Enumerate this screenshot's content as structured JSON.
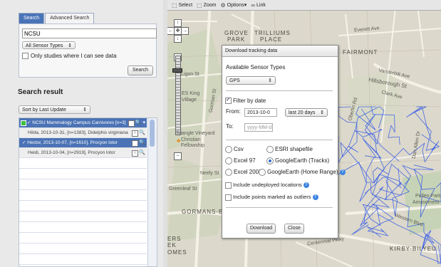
{
  "search_panel": {
    "tabs": [
      {
        "label": "Search"
      },
      {
        "label": "Advanced Search"
      }
    ],
    "query": "NCSU",
    "sensor_select": "All Sensor Types",
    "only_label": "Only studies where I can see data",
    "search_button": "Search"
  },
  "results": {
    "title": "Search result",
    "sort_select": "Sort by Last Update",
    "rows": [
      {
        "label": "NCSU Mammalogy Campus Carnivores [n=3]"
      },
      {
        "label": "Hilda, 2013-10-31, [n=1383], Didelphis virginiana"
      },
      {
        "label": "Hector, 2013-10-07, [n=1610], Procyon lotor"
      },
      {
        "label": "Heidi, 2013-10-04, [n=2919], Procyon lotor"
      }
    ]
  },
  "toolbar": {
    "select": "Select",
    "zoom": "Zoom",
    "options": "Options",
    "link": "Link"
  },
  "map_labels": [
    {
      "text": "GROVE"
    },
    {
      "text": "PARK"
    },
    {
      "text": "TRILLIUMS"
    },
    {
      "text": "PLACE"
    },
    {
      "text": "FAIRMONT"
    },
    {
      "text": "Everett Ave"
    },
    {
      "text": "ES King"
    },
    {
      "text": "Village"
    },
    {
      "text": "Ligon St"
    },
    {
      "text": "Gorman St"
    },
    {
      "text": "Triangle Vineyard"
    },
    {
      "text": "Christian"
    },
    {
      "text": "Fellowship"
    },
    {
      "text": "Greenleaf St"
    },
    {
      "text": "GORMANS-BURT"
    },
    {
      "text": "Hillsborough St"
    },
    {
      "text": "Neely St"
    },
    {
      "text": "Western Blvd"
    },
    {
      "text": "Centennial Pkwy"
    },
    {
      "text": "KIRBY-BILYEU"
    },
    {
      "text": "ERS"
    },
    {
      "text": "EK"
    },
    {
      "text": "OMES"
    },
    {
      "text": "Pullen Park"
    },
    {
      "text": "Amusement"
    },
    {
      "text": "Dan Allen Dr"
    },
    {
      "text": "Vanderbilt Ave"
    },
    {
      "text": "Clark Ave"
    },
    {
      "text": "Oberlin Rd"
    }
  ],
  "dialog": {
    "title": "Download tracking data",
    "sensor_label": "Available Sensor Types",
    "sensor_value": "GPS",
    "filter_label": "Filter by date",
    "from_label": "From:",
    "from_value": "2013-10-0",
    "range_value": "last 20 days",
    "to_label": "To:",
    "to_placeholder": "yyyy-MM-d",
    "formats": {
      "csv": "Csv",
      "esri": "ESRI shapefile",
      "excel97": "Excel 97",
      "ge_tracks": "GoogleEarth (Tracks)",
      "excel2007": "Excel 2007",
      "ge_home": "GoogleEarth (Home Range)"
    },
    "include_undeployed": "Include undeployed locations",
    "include_outliers": "Include points marked as outliers",
    "download_button": "Download",
    "close_button": "Close"
  },
  "colors": {
    "accent": "#4b73b5",
    "track": "#2b55e6"
  }
}
